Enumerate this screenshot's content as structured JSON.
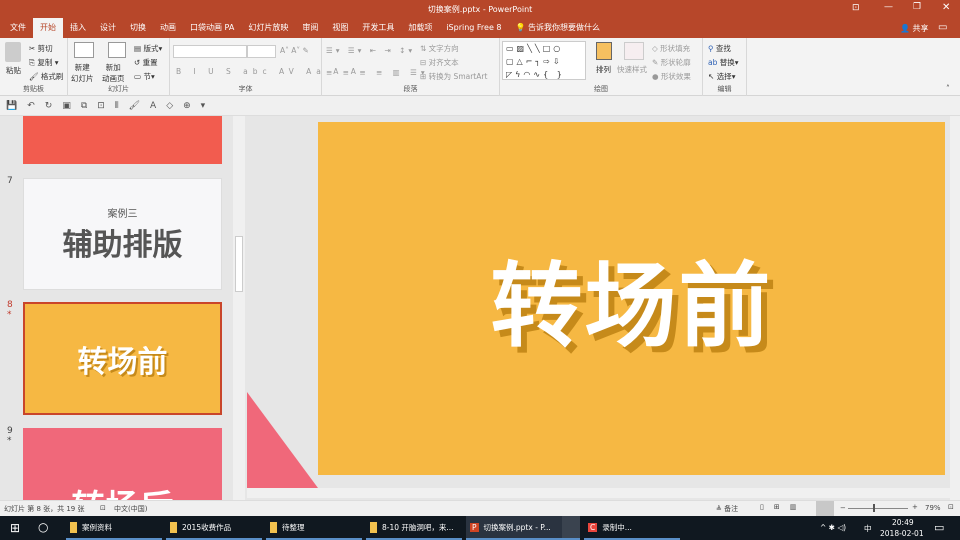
{
  "title": "切换案例.pptx - PowerPoint",
  "tabs": [
    "文件",
    "开始",
    "插入",
    "设计",
    "切换",
    "动画",
    "口袋动画 PA",
    "幻灯片放映",
    "审阅",
    "视图",
    "开发工具",
    "加载项",
    "iSpring Free 8"
  ],
  "tell_me": "告诉我你想要做什么",
  "share": "共享",
  "ribbon": {
    "clipboard": {
      "label": "剪贴板",
      "paste": "粘贴",
      "cut": "剪切",
      "copy": "复制",
      "format_painter": "格式刷"
    },
    "slides": {
      "label": "幻灯片",
      "new_slide": "新建\n幻灯片",
      "new_anim_page": "新加\n动画页",
      "layout": "版式",
      "reset": "重置",
      "section": "节"
    },
    "font": {
      "label": "字体"
    },
    "paragraph": {
      "label": "段落",
      "text_direction": "文字方向",
      "align_text": "对齐文本",
      "smartart": "转换为 SmartArt"
    },
    "drawing": {
      "label": "绘图",
      "arrange": "排列",
      "quick_styles": "快速样式",
      "shape_fill": "形状填充",
      "shape_outline": "形状轮廓",
      "shape_effects": "形状效果"
    },
    "editing": {
      "label": "编辑",
      "find": "查找",
      "replace": "替换",
      "select": "选择"
    }
  },
  "thumbnails": [
    {
      "num": "7",
      "subtitle": "案例三",
      "title": "辅助排版",
      "bg": "#f7f7f9"
    },
    {
      "num": "8",
      "title": "转场前",
      "bg": "#f6b843",
      "selected": true
    },
    {
      "num": "9",
      "title": "转场后",
      "bg": "#f0687a"
    }
  ],
  "slide": {
    "title": "转场前",
    "bg": "#f6b843"
  },
  "status": {
    "slide_info": "幻灯片 第 8 张，共 19 张",
    "language": "中文(中国)",
    "notes": "备注",
    "zoom": "79%"
  },
  "taskbar": {
    "items": [
      "案例资料",
      "2015收费作品",
      "待整理",
      "8-10 开脑洞吧，来...",
      "切换案例.pptx - P...",
      "录制中..."
    ],
    "time": "20:49",
    "date": "2018-02-01",
    "ime": "中"
  }
}
